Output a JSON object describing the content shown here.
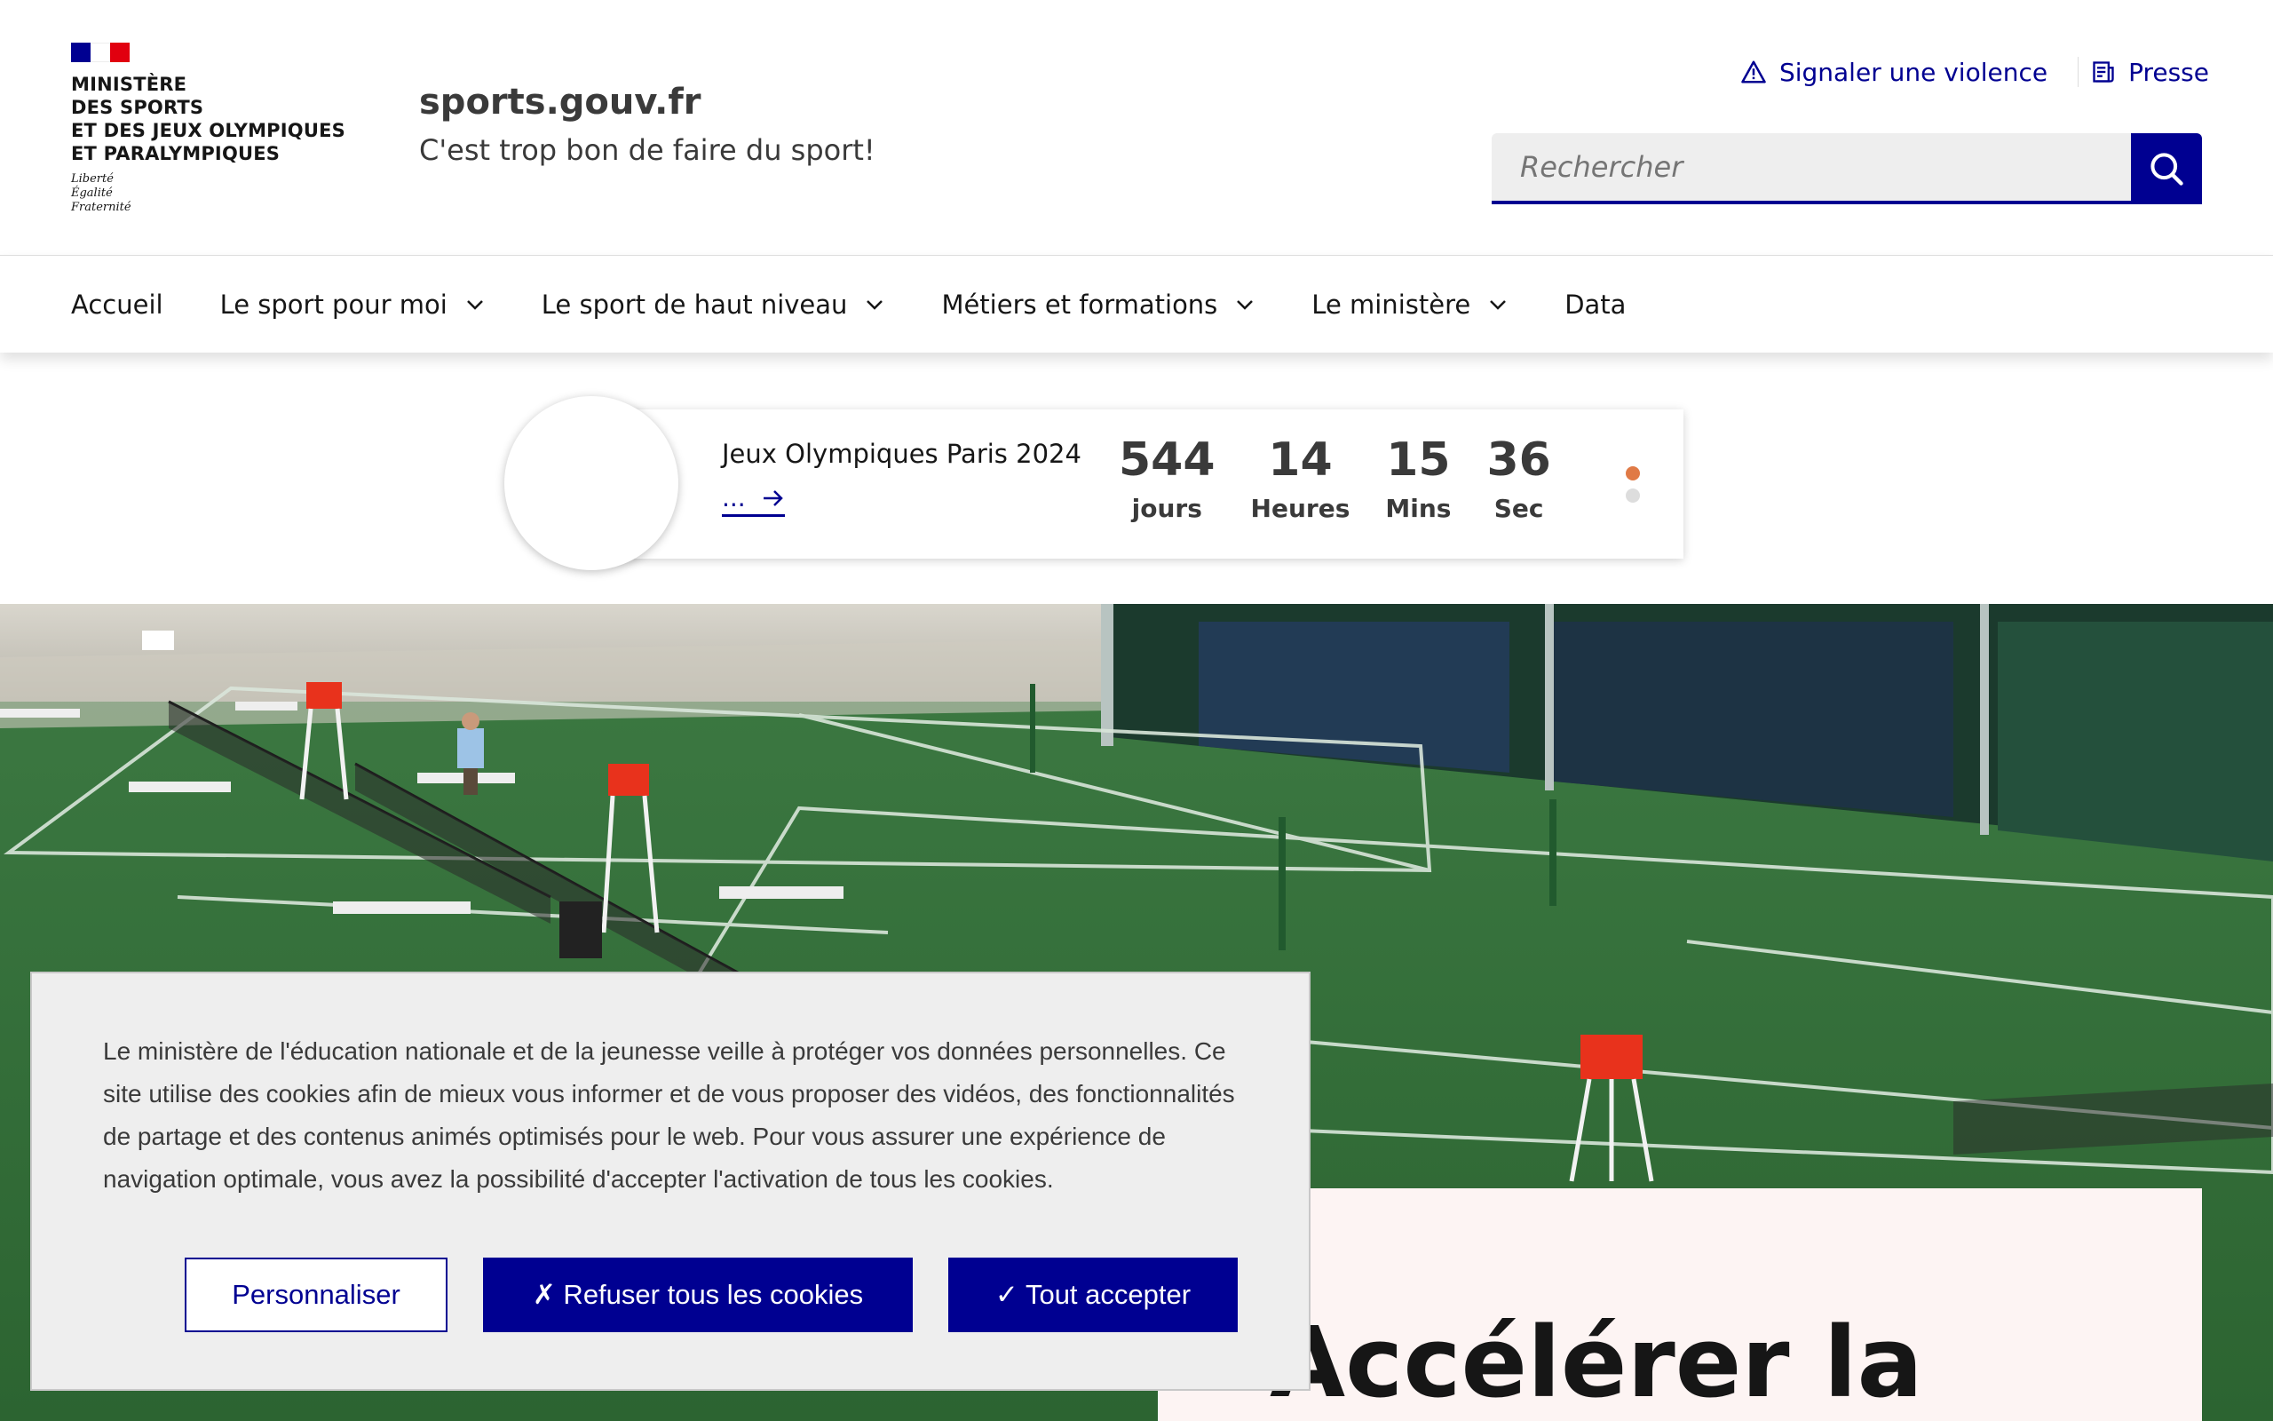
{
  "header": {
    "org_name": "MINISTÈRE\nDES SPORTS\nET DES JEUX OLYMPIQUES\nET PARALYMPIQUES",
    "motto": "Liberté\nÉgalité\nFraternité",
    "site_title": "sports.gouv.fr",
    "tagline": "C'est trop bon de faire du sport!",
    "links": [
      {
        "label": "Signaler une violence",
        "icon": "warning-icon"
      },
      {
        "label": "Presse",
        "icon": "newspaper-icon"
      }
    ],
    "search": {
      "placeholder": "Rechercher",
      "icon": "search-icon"
    }
  },
  "nav": {
    "items": [
      {
        "label": "Accueil",
        "dropdown": false
      },
      {
        "label": "Le sport pour moi",
        "dropdown": true
      },
      {
        "label": "Le sport de haut niveau",
        "dropdown": true
      },
      {
        "label": "Métiers et formations",
        "dropdown": true
      },
      {
        "label": "Le ministère",
        "dropdown": true
      },
      {
        "label": "Data",
        "dropdown": false
      }
    ]
  },
  "countdown": {
    "title": "Jeux Olympiques Paris 2024",
    "link_label": "...",
    "units": [
      {
        "value": "544",
        "label": "jours"
      },
      {
        "value": "14",
        "label": "Heures"
      },
      {
        "value": "15",
        "label": "Mins"
      },
      {
        "value": "36",
        "label": "Sec"
      }
    ],
    "carousel_dots": 2,
    "active_dot": 0
  },
  "hero": {
    "image": "indoor tennis courts",
    "heading": "Accélérer la"
  },
  "cookie_banner": {
    "text": "Le ministère de l'éducation nationale et de la jeunesse veille à protéger vos données personnelles. Ce site utilise des cookies afin de mieux vous informer et de vous proposer des vidéos, des fonctionnalités de partage et des contenus animés optimisés pour le web. Pour vous assurer une expérience de navigation optimale, vous avez la possibilité d'accepter l'activation de tous les cookies.",
    "customize_label": "Personnaliser",
    "refuse_label": "✗ Refuser tous les cookies",
    "accept_label": "✓ Tout accepter"
  },
  "colors": {
    "primary": "#000091",
    "marianne_red": "#e1000f",
    "accent_dot": "#e07a46",
    "court_green": "#2f6b35",
    "card_bg": "#fdf4f3"
  }
}
